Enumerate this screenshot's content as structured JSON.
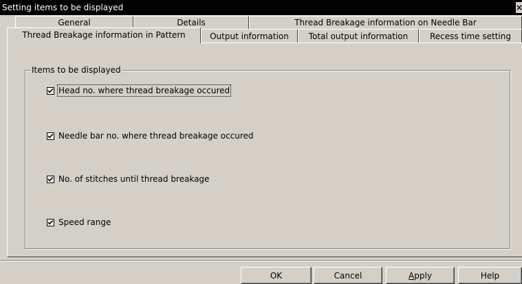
{
  "window": {
    "title": "Setting items to be displayed",
    "close_glyph": "×"
  },
  "tabs": {
    "row1": [
      {
        "label": "General"
      },
      {
        "label": "Details"
      },
      {
        "label": "Thread Breakage information on Needle Bar"
      }
    ],
    "row2": [
      {
        "label": "Thread Breakage information in Pattern",
        "active": true
      },
      {
        "label": "Output information"
      },
      {
        "label": "Total output information"
      },
      {
        "label": "Recess time setting"
      }
    ]
  },
  "group": {
    "title": "Items to be displayed",
    "items": [
      {
        "label": "Head no. where thread breakage occured",
        "checked": true
      },
      {
        "label": "Needle bar no. where thread breakage occured",
        "checked": true
      },
      {
        "label": "No. of stitches until thread breakage",
        "checked": true
      },
      {
        "label": "Speed range",
        "checked": true
      }
    ]
  },
  "buttons": {
    "ok": "OK",
    "cancel": "Cancel",
    "apply": "Apply",
    "help": "Help"
  }
}
